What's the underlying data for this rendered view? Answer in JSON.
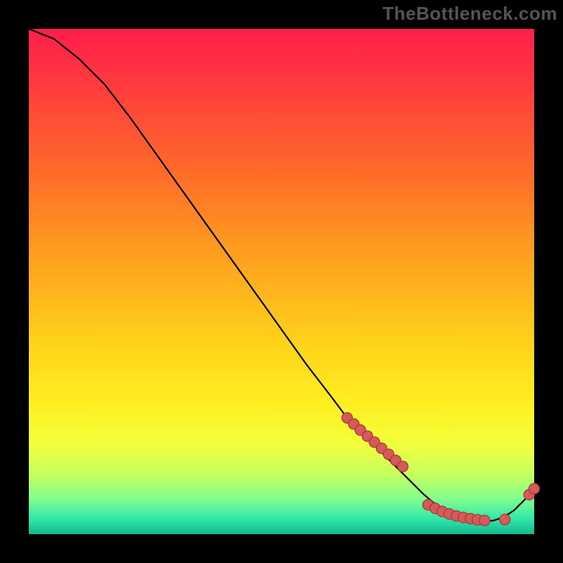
{
  "watermark": "TheBottleneck.com",
  "chart_data": {
    "type": "line",
    "title": "",
    "xlabel": "",
    "ylabel": "",
    "xlim": [
      0,
      100
    ],
    "ylim": [
      0,
      100
    ],
    "grid": false,
    "legend": false,
    "series": [
      {
        "name": "curve",
        "x": [
          0,
          5,
          10,
          15,
          20,
          25,
          30,
          35,
          40,
          45,
          50,
          55,
          60,
          63,
          65,
          67,
          69,
          71,
          73,
          75,
          78,
          80,
          82,
          84,
          86,
          88,
          90,
          92,
          94,
          96,
          98,
          99,
          100
        ],
        "y": [
          100,
          98,
          94,
          89,
          82.5,
          75.5,
          68.5,
          61.5,
          54.5,
          47.5,
          40.5,
          33.5,
          27,
          23,
          21,
          19,
          17,
          15,
          13,
          11,
          8,
          6.3,
          5,
          4,
          3.2,
          2.7,
          2.5,
          2.7,
          3.4,
          4.7,
          6.7,
          7.8,
          9
        ]
      }
    ],
    "scatter": {
      "name": "points",
      "x": [
        63,
        64.3,
        65.6,
        67,
        68.4,
        69.8,
        71.2,
        72.6,
        74,
        79,
        80.4,
        81.8,
        83.2,
        84.6,
        86,
        87.4,
        88.8,
        90.2,
        94.2,
        99,
        100
      ],
      "y": [
        23,
        21.8,
        20.6,
        19.4,
        18.2,
        17,
        15.8,
        14.6,
        13.4,
        5.8,
        5.1,
        4.5,
        4.0,
        3.6,
        3.3,
        3.05,
        2.85,
        2.7,
        2.9,
        7.8,
        9
      ]
    },
    "colors": {
      "line": "#000000",
      "points_fill": "#d65a5a",
      "points_stroke": "#a83d3d"
    }
  }
}
